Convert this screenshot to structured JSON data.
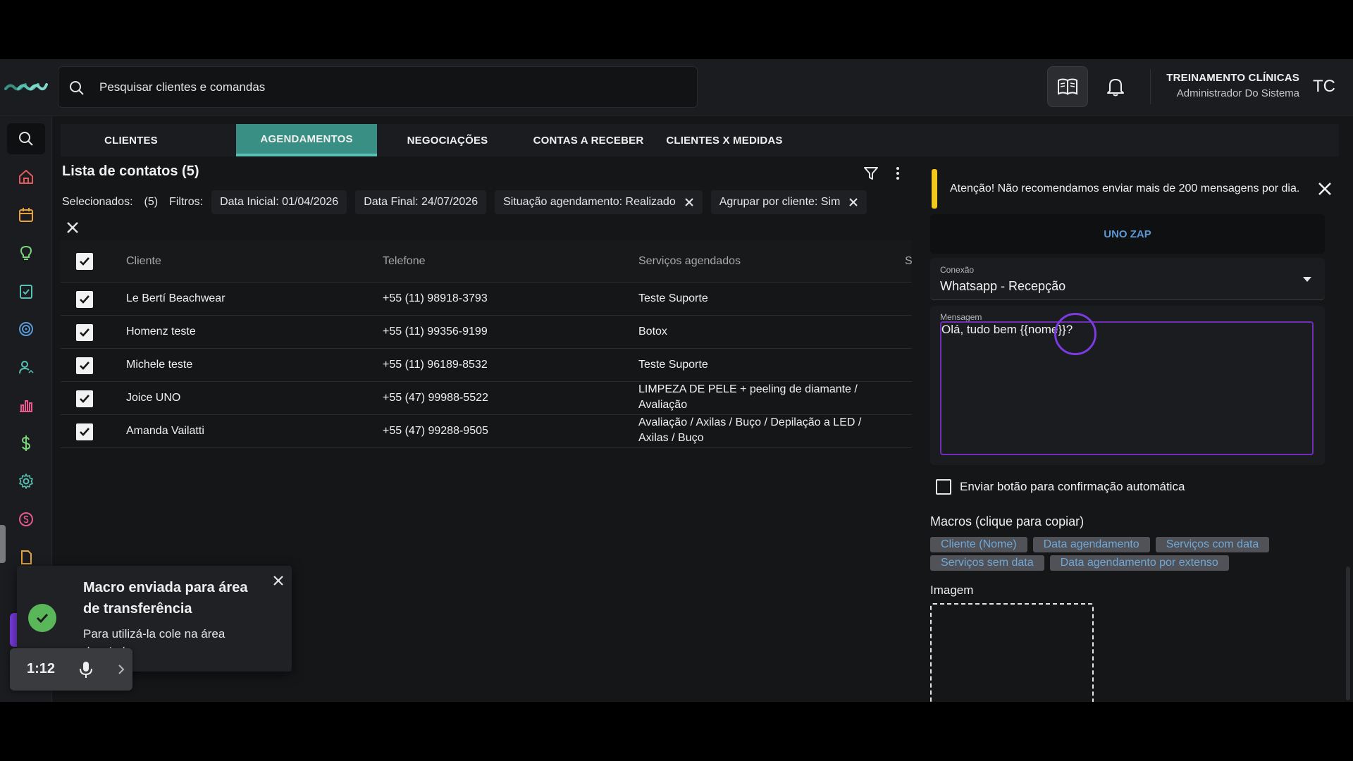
{
  "header": {
    "search_placeholder": "Pesquisar clientes e comandas",
    "company": "TREINAMENTO CLÍNICAS",
    "role": "Administrador Do Sistema",
    "avatar_initials": "TC"
  },
  "tabs": [
    {
      "label": "CLIENTES",
      "active": false
    },
    {
      "label": "AGENDAMENTOS",
      "active": true
    },
    {
      "label": "NEGOCIAÇÕES",
      "active": false
    },
    {
      "label": "CONTAS A RECEBER",
      "active": false
    },
    {
      "label": "CLIENTES X MEDIDAS",
      "active": false
    }
  ],
  "list": {
    "title": "Lista de contatos (5)",
    "selected_label": "Selecionados:",
    "selected_count": "(5)",
    "filters_label": "Filtros:",
    "chips": {
      "start": "Data Inicial: 01/04/2026",
      "end": "Data Final: 24/07/2026",
      "status": "Situação agendamento: Realizado",
      "group": "Agrupar por cliente: Sim"
    }
  },
  "table": {
    "columns": {
      "client": "Cliente",
      "phone": "Telefone",
      "services": "Serviços agendados",
      "extra": "S"
    },
    "rows": [
      {
        "client": "Le Bertí Beachwear",
        "phone": "+55 (11) 98918-3793",
        "services": "Teste Suporte"
      },
      {
        "client": "Homenz teste",
        "phone": "+55 (11) 99356-9199",
        "services": "Botox"
      },
      {
        "client": "Michele teste",
        "phone": "+55 (11) 96189-8532",
        "services": "Teste Suporte"
      },
      {
        "client": "Joice UNO",
        "phone": "+55 (47) 99988-5522",
        "services": "LIMPEZA DE PELE + peeling de diamante / Avaliação"
      },
      {
        "client": "Amanda Vailatti",
        "phone": "+55 (47) 99288-9505",
        "services": "Avaliação / Axilas / Buço / Depilação a LED / Axilas / Buço"
      }
    ]
  },
  "panel": {
    "alert": "Atenção! Não recomendamos enviar mais de 200 mensagens por dia.",
    "unozap": "UNO ZAP",
    "connection_label": "Conexão",
    "connection_value": "Whatsapp - Recepção",
    "message_label": "Mensagem",
    "message_value": "Olá, tudo bem {{nome}}?",
    "auto_confirm": "Enviar botão para confirmação automática",
    "macros_title": "Macros (clique para copiar)",
    "macros": [
      "Cliente (Nome)",
      "Data agendamento",
      "Serviços com data",
      "Serviços sem data",
      "Data agendamento por extenso"
    ],
    "image_label": "Imagem"
  },
  "toast": {
    "title": "Macro enviada para área de transferência",
    "body": "Para utilizá-la cole na área desejada"
  },
  "recorder": {
    "time": "1:12"
  },
  "colors": {
    "accent": "#3a8f84",
    "warning": "#f2c81c",
    "success": "#59b75a",
    "focus": "#6f2db8",
    "link": "#5b98d6"
  }
}
